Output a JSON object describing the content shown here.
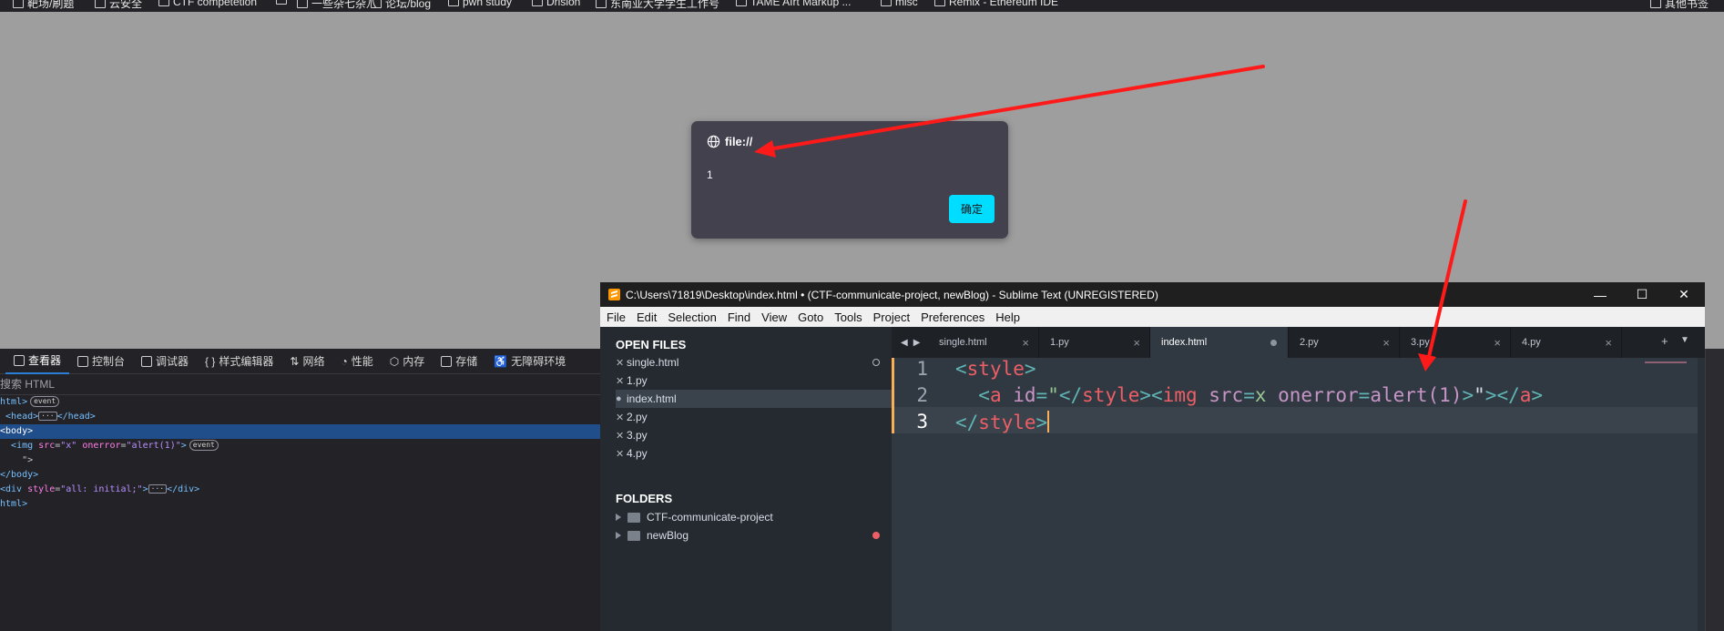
{
  "bookmarks": [
    {
      "label": "靶场/刷题"
    },
    {
      "label": "云安全"
    },
    {
      "label": "CTF competetion"
    },
    {
      "label": ""
    },
    {
      "label": "一些杂七杂八"
    },
    {
      "label": "论坛/blog"
    },
    {
      "label": "pwn study"
    },
    {
      "label": "Drision"
    },
    {
      "label": "东南亚大学学生工作号"
    },
    {
      "label": "TAME AIrt Markup ..."
    },
    {
      "label": "misc"
    },
    {
      "label": "Remix - Ethereum IDE"
    },
    {
      "label": "其他书签"
    }
  ],
  "alert": {
    "origin": "file://",
    "message": "1",
    "ok_label": "确定"
  },
  "devtools": {
    "tabs": [
      "查看器",
      "控制台",
      "调试器",
      "样式编辑器",
      "网络",
      "性能",
      "内存",
      "存储",
      "无障碍环境"
    ],
    "search_placeholder": "搜索 HTML",
    "event_badge": "event",
    "dom": [
      {
        "text": "html>"
      },
      {
        "text": "<head>",
        "close": "</head>"
      },
      {
        "text": "<body>"
      },
      {
        "tag": "<img ",
        "a1": "src",
        "v1": "\"x\"",
        "a2": "onerror",
        "v2": "\"alert(1)\"",
        "end": ">"
      },
      {
        "text": "\">"
      },
      {
        "text": "</body>"
      },
      {
        "tag": "<div ",
        "a1": "style",
        "v1": "\"all: initial;\"",
        "end": ">",
        "close": "</div>"
      },
      {
        "text": "html>"
      }
    ]
  },
  "sublime": {
    "title": "C:\\Users\\71819\\Desktop\\index.html • (CTF-communicate-project, newBlog) - Sublime Text (UNREGISTERED)",
    "menu": [
      "File",
      "Edit",
      "Selection",
      "Find",
      "View",
      "Goto",
      "Tools",
      "Project",
      "Preferences",
      "Help"
    ],
    "open_files_header": "OPEN FILES",
    "open_files": [
      "single.html",
      "1.py",
      "index.html",
      "2.py",
      "3.py",
      "4.py"
    ],
    "folders_header": "FOLDERS",
    "folders": [
      "CTF-communicate-project",
      "newBlog"
    ],
    "tabs": [
      "single.html",
      "1.py",
      "index.html",
      "2.py",
      "3.py",
      "4.py"
    ],
    "line_numbers": [
      "1",
      "2",
      "3"
    ],
    "code": {
      "l1_open": "<",
      "l1_tag": "style",
      "l1_close": ">",
      "l2_indent": "  ",
      "l2_open": "<",
      "l2_tag": "a",
      "l2_attr": " id",
      "l2_eq": "=",
      "l2_q": "\"",
      "l2_s1": "</",
      "l2_s2": "style",
      "l2_s3": "><",
      "l2_s4": "img",
      "l2_s5": " src",
      "l2_s6": "=",
      "l2_s7": "x",
      "l2_s8": " onerror",
      "l2_s9": "=",
      "l2_s10": "alert(1)",
      "l2_s11": ">",
      "l2_q2": "\"",
      "l2_close": ">",
      "l2_end_open": "</",
      "l2_end_tag": "a",
      "l2_end_close": ">",
      "l3_open": "</",
      "l3_tag": "style",
      "l3_close": ">"
    }
  },
  "annotation_color": "#ff1a1a"
}
